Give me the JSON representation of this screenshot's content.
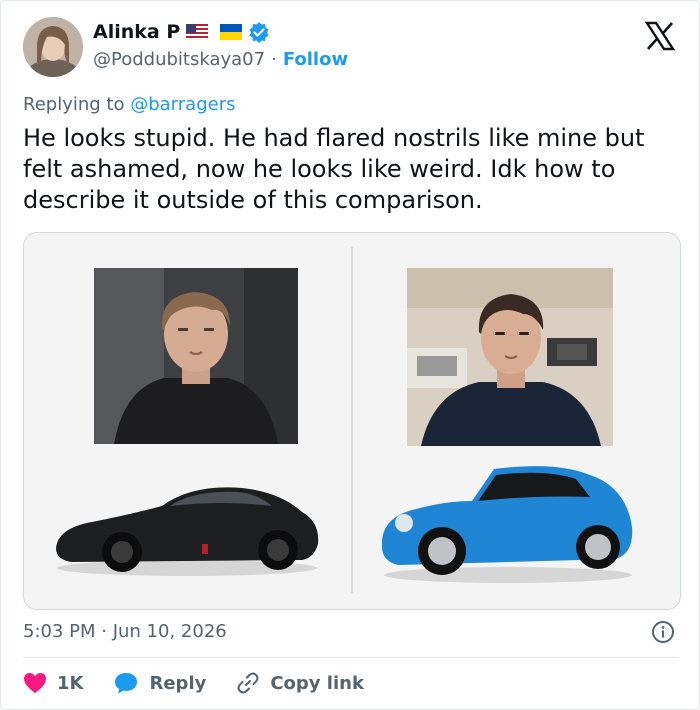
{
  "author": {
    "name": "Alinka P",
    "handle": "@Poddubitskaya07",
    "separator": "·",
    "follow_label": "Follow",
    "flags": [
      "us-flag-icon",
      "ukraine-flag-icon"
    ],
    "verified_badge": "verified-badge-icon"
  },
  "reply_context": {
    "prefix": "Replying to",
    "mention": "@barragers"
  },
  "tweet": {
    "text": "He looks stupid. He had flared nostrils like mine but felt ashamed, now he looks like weird. Idk how to describe it outside of this comparison."
  },
  "media": {
    "left_panel": {
      "photo": "man-portrait-dark-background",
      "car": "black-sports-car",
      "car_color": "#1c1e20"
    },
    "right_panel": {
      "photo": "man-portrait-kitchen-background",
      "car": "blue-convertible-beetle",
      "car_color": "#1f86d6"
    }
  },
  "meta": {
    "time": "5:03 PM",
    "separator": "·",
    "date": "Jun 10, 2026"
  },
  "actions": {
    "like_count": "1K",
    "reply_label": "Reply",
    "copy_label": "Copy link"
  },
  "colors": {
    "accent": "#1d9bf0",
    "like": "#f91880",
    "secondary_text": "#536471",
    "border": "#e1e8ed"
  }
}
